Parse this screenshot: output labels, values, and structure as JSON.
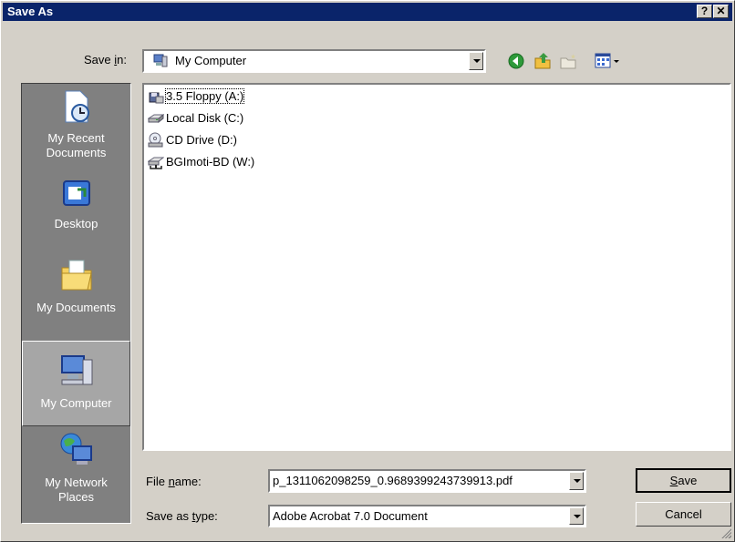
{
  "window": {
    "title": "Save As",
    "help_label": "?",
    "close_label": "✕"
  },
  "save_in": {
    "label_pre": "Save ",
    "label_key": "i",
    "label_post": "n:",
    "value": "My Computer"
  },
  "toolbar": {
    "icons": [
      "back-icon",
      "up-folder-icon",
      "new-folder-icon",
      "views-menu-icon"
    ]
  },
  "places": [
    {
      "label": "My Recent\nDocuments",
      "icon": "recent-documents-icon"
    },
    {
      "label": "Desktop",
      "icon": "desktop-icon"
    },
    {
      "label": "My Documents",
      "icon": "my-documents-icon"
    },
    {
      "label": "My Computer",
      "icon": "my-computer-icon",
      "selected": true
    },
    {
      "label": "My Network\nPlaces",
      "icon": "network-places-icon"
    }
  ],
  "files": [
    {
      "name": "3.5 Floppy (A:)",
      "icon": "floppy-drive-icon"
    },
    {
      "name": "Local Disk (C:)",
      "icon": "hard-disk-icon"
    },
    {
      "name": "CD Drive (D:)",
      "icon": "cd-drive-icon"
    },
    {
      "name": "BGImoti-BD (W:)",
      "icon": "network-drive-icon"
    }
  ],
  "file_name": {
    "label_pre": "File ",
    "label_key": "n",
    "label_post": "ame:",
    "value": "p_1311062098259_0.9689399243739913.pdf"
  },
  "save_type": {
    "label_pre": "Save as ",
    "label_key": "t",
    "label_post": "ype:",
    "value": "Adobe Acrobat 7.0 Document"
  },
  "buttons": {
    "save_key": "S",
    "save_rest": "ave",
    "cancel": "Cancel"
  },
  "colors": {
    "titlebar": "#0a246a",
    "face": "#d4d0c8",
    "places_bg": "#808080"
  }
}
